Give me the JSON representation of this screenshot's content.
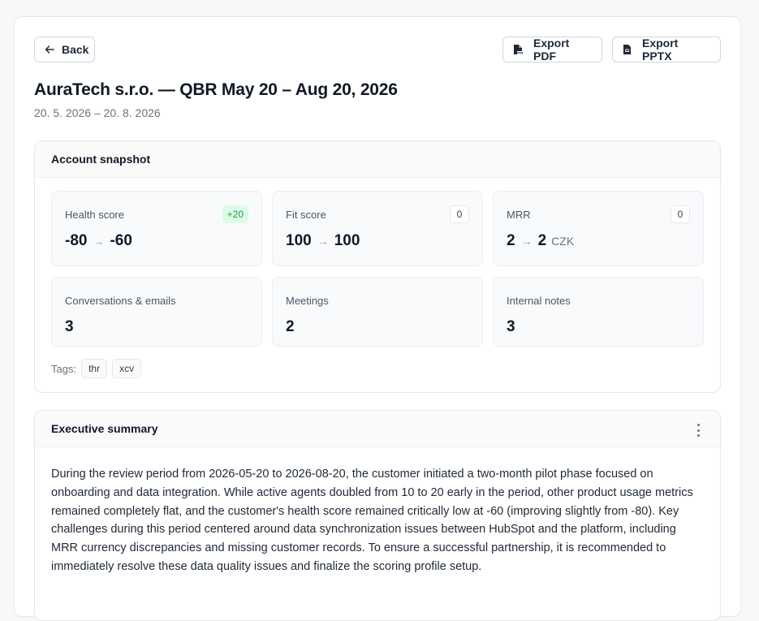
{
  "header": {
    "back_label": "Back",
    "export_pdf_label": "Export PDF",
    "export_pptx_label": "Export PPTX",
    "title": "AuraTech s.r.o. — QBR May 20 – Aug 20, 2026",
    "date_range": "20. 5. 2026 – 20. 8. 2026"
  },
  "snapshot": {
    "title": "Account snapshot",
    "health": {
      "label": "Health score",
      "from": "-80",
      "to": "-60",
      "delta": "+20"
    },
    "fit": {
      "label": "Fit score",
      "from": "100",
      "to": "100",
      "delta": "0"
    },
    "mrr": {
      "label": "MRR",
      "from": "2",
      "to": "2",
      "unit": "CZK",
      "delta": "0"
    },
    "conversations": {
      "label": "Conversations & emails",
      "value": "3"
    },
    "meetings": {
      "label": "Meetings",
      "value": "2"
    },
    "notes": {
      "label": "Internal notes",
      "value": "3"
    },
    "tags_label": "Tags:",
    "tags": [
      "thr",
      "xcv"
    ]
  },
  "summary": {
    "title": "Executive summary",
    "text": "During the review period from 2026-05-20 to 2026-08-20, the customer initiated a two-month pilot phase focused on onboarding and data integration. While active agents doubled from 10 to 20 early in the period, other product usage metrics remained completely flat, and the customer's health score remained critically low at -60 (improving slightly from -80). Key challenges during this period centered around data synchronization issues between HubSpot and the platform, including MRR currency discrepancies and missing customer records. To ensure a successful partnership, it is recommended to immediately resolve these data quality issues and finalize the scoring profile setup."
  },
  "icons": {
    "back": "arrow-left-icon",
    "pdf": "file-pdf-icon",
    "pptx": "file-presentation-icon",
    "arrow": "→"
  },
  "colors": {
    "positive_delta_bg": "#dcfce7",
    "positive_delta_text": "#16a34a"
  }
}
